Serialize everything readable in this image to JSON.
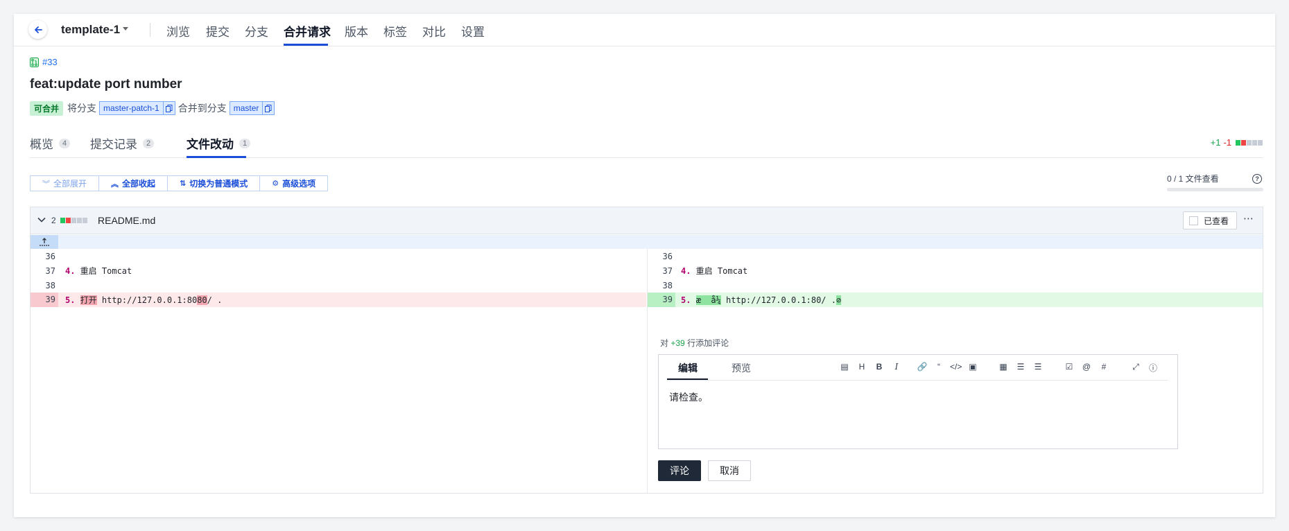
{
  "header": {
    "repo_name": "template-1",
    "nav_tabs": [
      "浏览",
      "提交",
      "分支",
      "合并请求",
      "版本",
      "标签",
      "对比",
      "设置"
    ],
    "active_tab": "合并请求"
  },
  "mr": {
    "id": "#33",
    "title": "feat:update port number",
    "status": "可合并",
    "text_from": "将分支",
    "source_branch": "master-patch-1",
    "text_into": "合并到分支",
    "target_branch": "master"
  },
  "subtabs": [
    {
      "label": "概览",
      "count": "4"
    },
    {
      "label": "提交记录",
      "count": "2"
    },
    {
      "label": "文件改动",
      "count": "1"
    }
  ],
  "diffstat": {
    "plus": "+1",
    "minus": "-1"
  },
  "toolbar": {
    "expand_all": "全部展开",
    "collapse_all": "全部收起",
    "switch_mode": "切换为普通模式",
    "advanced": "高级选项"
  },
  "viewed_progress": {
    "text": "0 / 1 文件查看",
    "fraction": 0.0
  },
  "file": {
    "count": "2",
    "name": "README.md",
    "viewed_label": "已查看",
    "expand_glyph": "⋯"
  },
  "diff": {
    "left": [
      {
        "ln": "36",
        "num": "",
        "text": ""
      },
      {
        "ln": "37",
        "num": "4.",
        "text": " 重启 Tomcat"
      },
      {
        "ln": "38",
        "num": "",
        "text": ""
      },
      {
        "ln": "39",
        "num": "5.",
        "hl": "打开",
        "pre": " ",
        "text": " http://127.0.0.1:80",
        "hl2": "80",
        "post": "/ ."
      }
    ],
    "right": [
      {
        "ln": "36",
        "num": "",
        "text": ""
      },
      {
        "ln": "37",
        "num": "4.",
        "text": " 重启 Tomcat"
      },
      {
        "ln": "38",
        "num": "",
        "text": ""
      },
      {
        "ln": "39",
        "num": "5.",
        "hl": "æ  å¼",
        "text": " http://127.0.0.1:80/ ."
      }
    ]
  },
  "comment": {
    "prefix": "对",
    "line_ref": "+39",
    "suffix": "行添加评论",
    "tab_edit": "编辑",
    "tab_preview": "预览",
    "content": "请检查。",
    "submit": "评论",
    "cancel": "取消"
  },
  "colors": {
    "accent": "#1a4ed8",
    "added": "#22c55e",
    "removed": "#ef4444"
  }
}
